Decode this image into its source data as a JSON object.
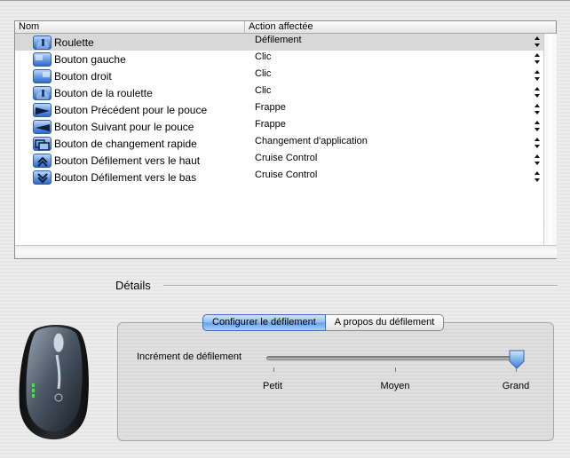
{
  "table": {
    "columns": {
      "name": "Nom",
      "action": "Action affectée"
    },
    "rows": [
      {
        "icon": "scroll-wheel-icon",
        "name": "Roulette",
        "action": "Défilement",
        "selected": true
      },
      {
        "icon": "left-button-icon",
        "name": "Bouton gauche",
        "action": "Clic"
      },
      {
        "icon": "right-button-icon",
        "name": "Bouton droit",
        "action": "Clic"
      },
      {
        "icon": "wheel-button-icon",
        "name": "Bouton de la roulette",
        "action": "Clic"
      },
      {
        "icon": "thumb-back-icon",
        "name": "Bouton Précédent pour le pouce",
        "action": "Frappe"
      },
      {
        "icon": "thumb-forward-icon",
        "name": "Bouton Suivant pour le pouce",
        "action": "Frappe"
      },
      {
        "icon": "quick-switch-icon",
        "name": "Bouton de changement rapide",
        "action": "Changement d'application"
      },
      {
        "icon": "scroll-up-icon",
        "name": "Bouton Défilement vers le haut",
        "action": "Cruise Control"
      },
      {
        "icon": "scroll-down-icon",
        "name": "Bouton Défilement vers le bas",
        "action": "Cruise Control"
      }
    ]
  },
  "details": {
    "label": "Détails",
    "tabs": [
      {
        "label": "Configurer le défilement",
        "active": true
      },
      {
        "label": "A propos du défilement",
        "active": false
      }
    ],
    "slider": {
      "label": "Incrément de défilement",
      "value_fraction": 1.0,
      "ticks": [
        "Petit",
        "Moyen",
        "Grand"
      ]
    }
  },
  "colors": {
    "selection": "#d8d8d8",
    "accent_blue": "#6a9ee6"
  }
}
